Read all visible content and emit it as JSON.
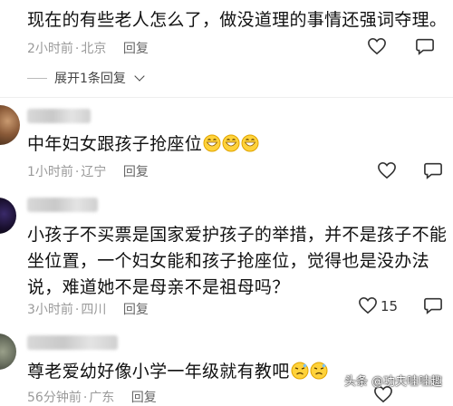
{
  "comments": [
    {
      "text": "现在的有些老人怎么了，做没道理的事情还强词夺理。",
      "time": "2小时前",
      "location": "北京",
      "reply_label": "回复",
      "expand_label": "展开1条回复"
    },
    {
      "text": "中年妇女跟孩子抢座位",
      "emoji_count": 3,
      "time": "1小时前",
      "location": "辽宁",
      "reply_label": "回复"
    },
    {
      "text_lines": [
        "小孩子不买票是国家爱护孩子的举措，并不是孩子不能",
        "坐位置，一个妇女能和孩子抢座位，觉得也是没办法",
        "说，难道她不是母亲不是祖母吗？"
      ],
      "time": "3小时前",
      "location": "四川",
      "reply_label": "回复",
      "like_count": "15"
    },
    {
      "text": "尊老爱幼好像小学一年级就有教吧",
      "time": "56分钟前",
      "location": "广东",
      "reply_label": "回复"
    }
  ],
  "icons": {
    "like": "heart-outline-icon",
    "comment": "comment-bubble-icon",
    "emoji_grin": "grinning-emoji",
    "emoji_tired": "tired-face-emoji"
  },
  "watermark": "头条 @功夫哇哇趣",
  "colors": {
    "meta_gray": "#9a9a9a",
    "text": "#111111"
  }
}
